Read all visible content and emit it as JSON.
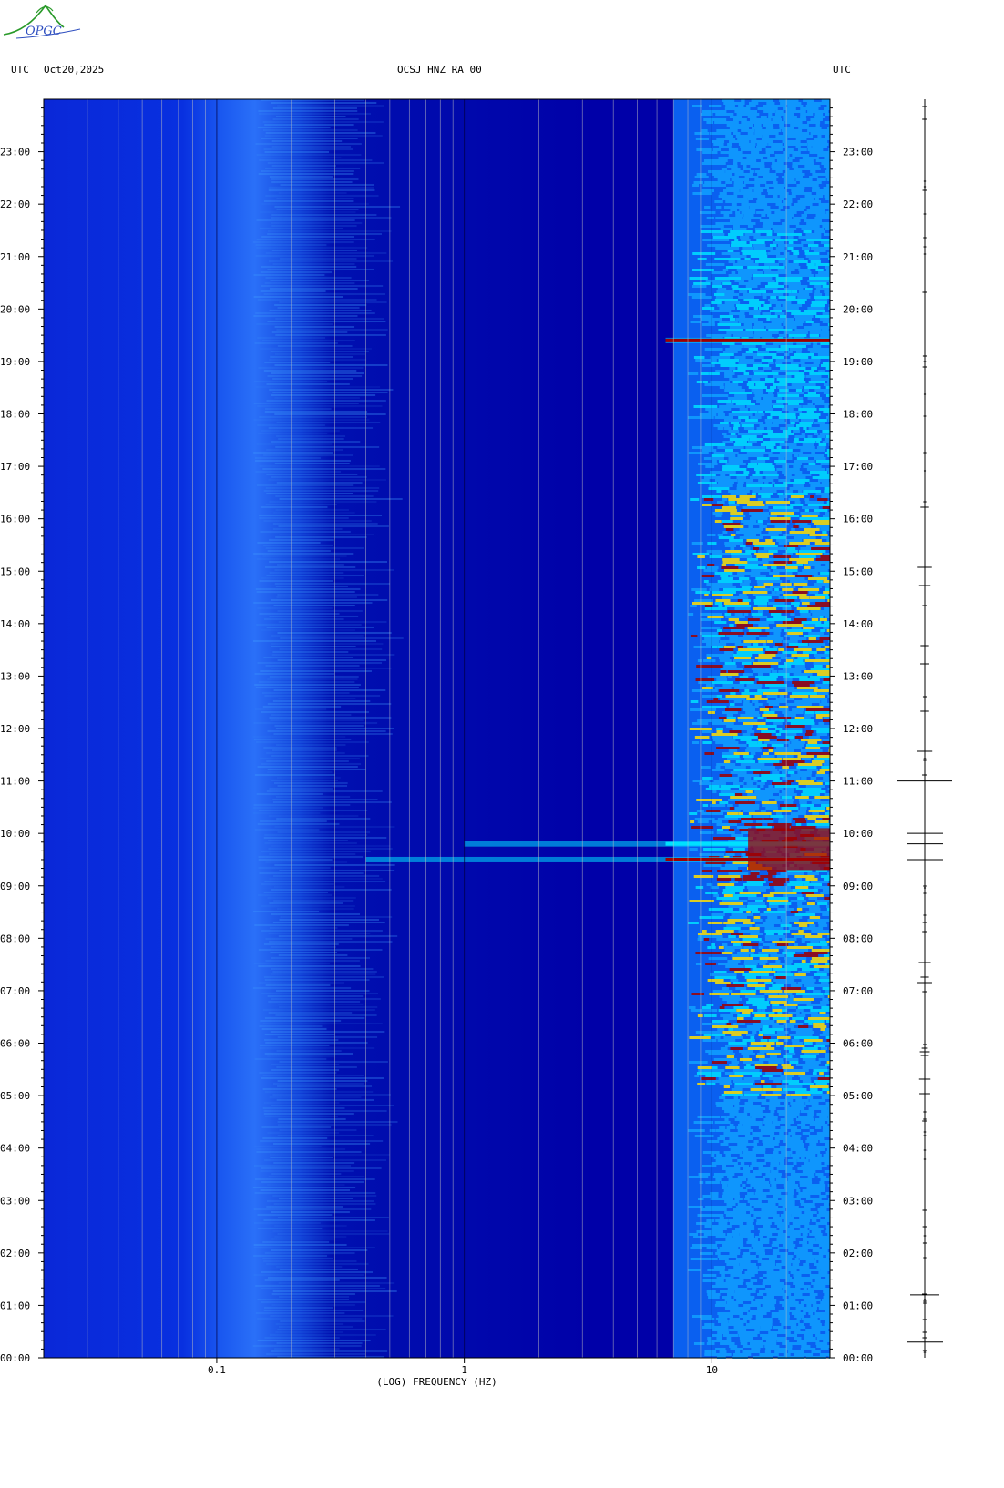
{
  "header": {
    "left_utc": "UTC",
    "date": "Oct20,2025",
    "station": "OCSJ HNZ RA 00",
    "right_utc": "UTC"
  },
  "logo": {
    "text": "OPGC"
  },
  "colors": {
    "background_low": "#0000a8",
    "background_mid": "#1040e0",
    "high": "#00e0ff",
    "peak": "#ffe000",
    "max": "#a00000"
  },
  "chart_data": {
    "type": "heatmap",
    "title": "OCSJ HNZ RA 00",
    "xlabel": "(LOG) FREQUENCY (HZ)",
    "ylabel": "UTC",
    "x_scale": "log",
    "xlim": [
      0.02,
      30
    ],
    "x_ticks": [
      {
        "value": 0.1,
        "label": "0.1"
      },
      {
        "value": 1,
        "label": "1"
      },
      {
        "value": 10,
        "label": "10"
      }
    ],
    "ylim_hours": [
      0,
      24
    ],
    "y_ticks": [
      "00:00",
      "01:00",
      "02:00",
      "03:00",
      "04:00",
      "05:00",
      "06:00",
      "07:00",
      "08:00",
      "09:00",
      "10:00",
      "11:00",
      "12:00",
      "13:00",
      "14:00",
      "15:00",
      "16:00",
      "17:00",
      "18:00",
      "19:00",
      "20:00",
      "21:00",
      "22:00",
      "23:00"
    ],
    "events": [
      {
        "time_hours": 9.5,
        "freq_min_hz": 0.4,
        "freq_max_hz": 30,
        "intensity": "max"
      },
      {
        "time_hours": 9.8,
        "freq_min_hz": 1.0,
        "freq_max_hz": 30,
        "intensity": "high"
      },
      {
        "time_hours": 19.4,
        "freq_min_hz": 6.5,
        "freq_max_hz": 30,
        "intensity": "max"
      }
    ],
    "trace_event_hours": [
      0.3,
      1.2,
      9.5,
      9.8,
      10.0,
      11.0
    ]
  }
}
